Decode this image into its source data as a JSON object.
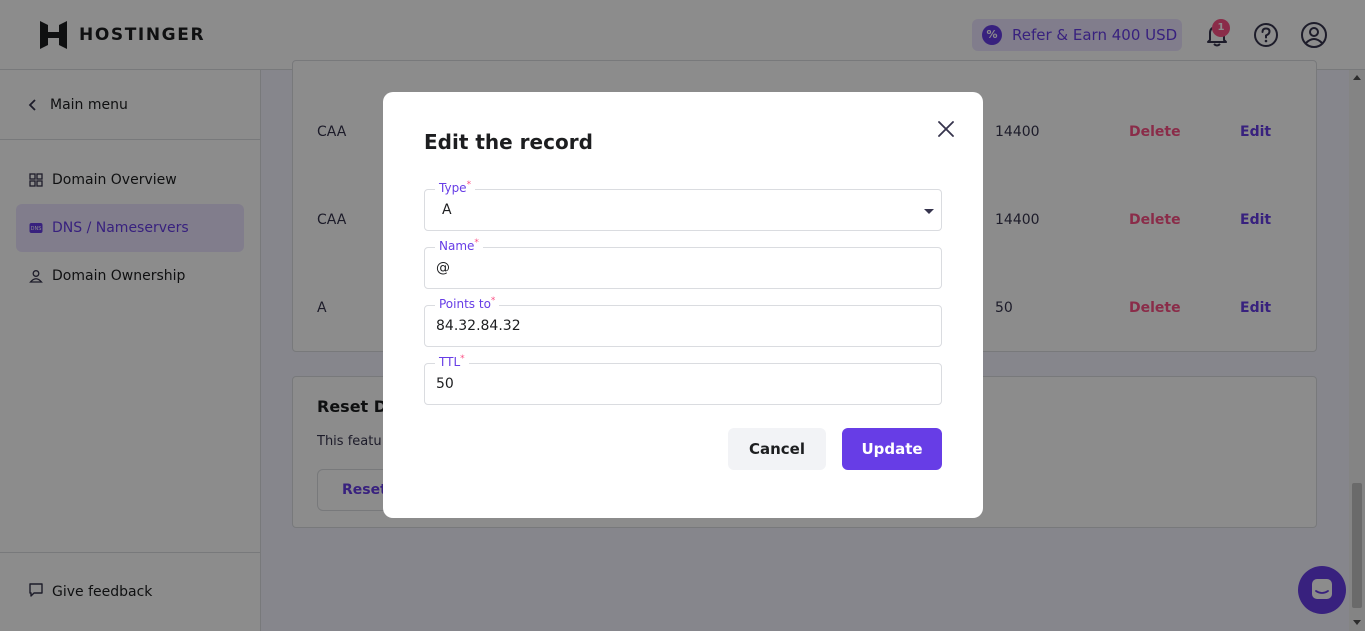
{
  "header": {
    "brand": "HOSTINGER",
    "refer_label": "Refer & Earn 400 USD",
    "notification_count": "1",
    "icons": [
      "bell-icon",
      "help-icon",
      "account-icon"
    ]
  },
  "sidebar": {
    "main_menu": "Main menu",
    "items": [
      {
        "label": "Domain Overview",
        "icon": "grid-icon"
      },
      {
        "label": "DNS / Nameservers",
        "icon": "dns-icon",
        "active": true
      },
      {
        "label": "Domain Ownership",
        "icon": "user-icon"
      }
    ],
    "feedback": "Give feedback"
  },
  "records": {
    "rows": [
      {
        "type": "CAA",
        "ttl": "14400",
        "delete": "Delete",
        "edit": "Edit"
      },
      {
        "type": "CAA",
        "ttl": "14400",
        "delete": "Delete",
        "edit": "Edit"
      },
      {
        "type": "A",
        "ttl": "50",
        "delete": "Delete",
        "edit": "Edit"
      }
    ]
  },
  "reset": {
    "title": "Reset DN",
    "description": "This featu",
    "button": "Reset"
  },
  "modal": {
    "title": "Edit the record",
    "type_label": "Type",
    "type_value": "A",
    "name_label": "Name",
    "name_value": "@",
    "points_label": "Points to",
    "points_value": "84.32.84.32",
    "ttl_label": "TTL",
    "ttl_value": "50",
    "required_mark": "*",
    "cancel": "Cancel",
    "update": "Update"
  },
  "colors": {
    "accent": "#673de6",
    "danger": "#fc5185",
    "accent_light": "#ebe4ff"
  }
}
